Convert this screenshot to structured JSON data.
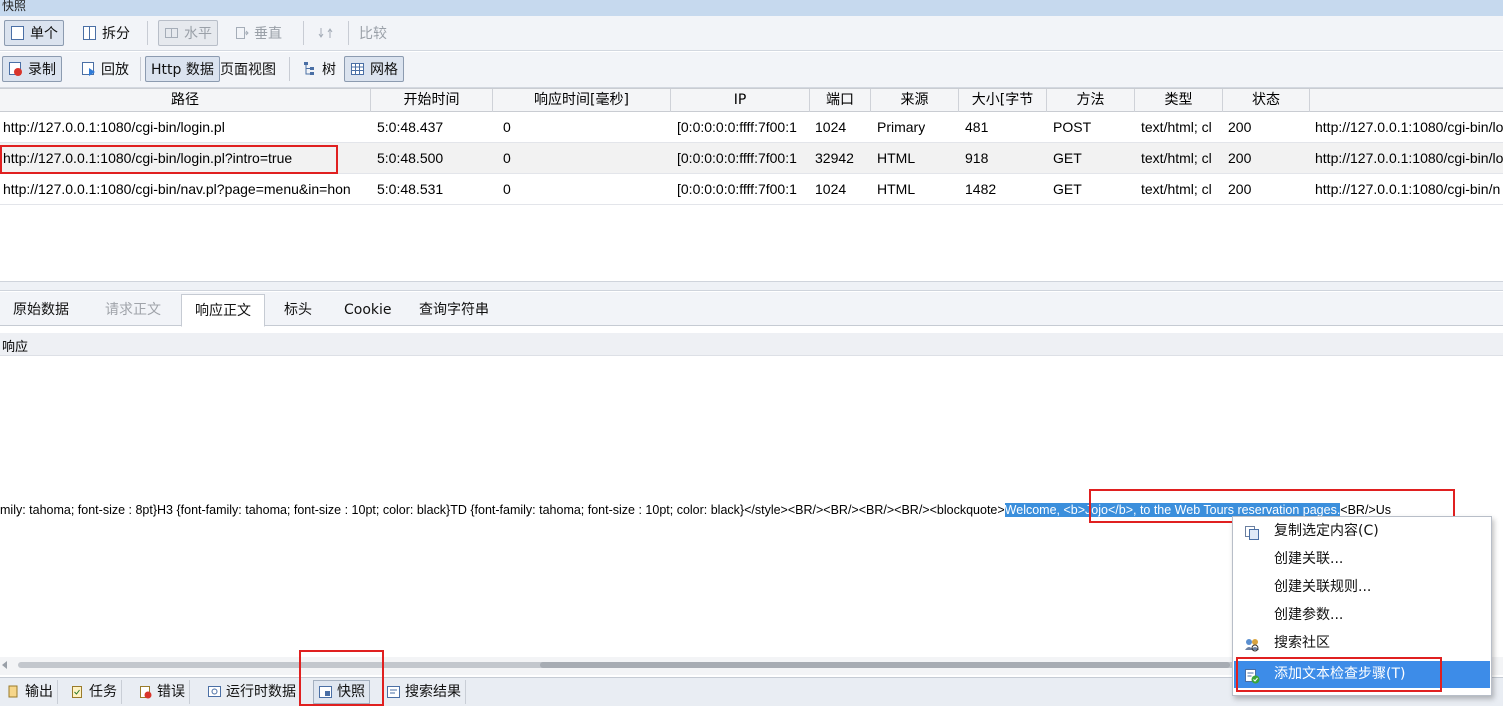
{
  "window": {
    "title": "快照"
  },
  "toolbar1": {
    "single_label": "单个",
    "split_label": "拆分",
    "horizontal_label": "水平",
    "vertical_label": "垂直",
    "compare_label": "比较"
  },
  "toolbar2": {
    "record_label": "录制",
    "replay_label": "回放",
    "http_data_label": "Http 数据",
    "page_view_label": "页面视图",
    "tree_label": "树",
    "grid_label": "网格"
  },
  "grid": {
    "columns": [
      "路径",
      "开始时间",
      "响应时间[毫秒]",
      "IP",
      "端口",
      "来源",
      "大小[字节",
      "方法",
      "类型",
      "状态"
    ],
    "rows": [
      {
        "path": "http://127.0.0.1:1080/cgi-bin/login.pl",
        "start": "5:0:48.437",
        "resp": "0",
        "ip": "[0:0:0:0:0:ffff:7f00:1",
        "port": "1024",
        "source": "Primary",
        "size": "481",
        "method": "POST",
        "type": "text/html; cl",
        "status": "200",
        "referer": "http://127.0.0.1:1080/cgi-bin/lo"
      },
      {
        "path": "http://127.0.0.1:1080/cgi-bin/login.pl?intro=true",
        "start": "5:0:48.500",
        "resp": "0",
        "ip": "[0:0:0:0:0:ffff:7f00:1",
        "port": "32942",
        "source": "HTML",
        "size": "918",
        "method": "GET",
        "type": "text/html; cl",
        "status": "200",
        "referer": "http://127.0.0.1:1080/cgi-bin/lo"
      },
      {
        "path": "http://127.0.0.1:1080/cgi-bin/nav.pl?page=menu&in=hon",
        "start": "5:0:48.531",
        "resp": "0",
        "ip": "[0:0:0:0:0:ffff:7f00:1",
        "port": "1024",
        "source": "HTML",
        "size": "1482",
        "method": "GET",
        "type": "text/html; cl",
        "status": "200",
        "referer": "http://127.0.0.1:1080/cgi-bin/n"
      }
    ]
  },
  "detail_tabs": [
    "原始数据",
    "请求正文",
    "响应正文",
    "标头",
    "Cookie",
    "查询字符串"
  ],
  "response": {
    "section_label": "响应",
    "text_before": "mily: tahoma; font-size : 8pt}H3 {font-family: tahoma; font-size : 10pt; color: black}TD {font-family: tahoma; font-size : 10pt; color: black}</style><BR/><BR/><BR/><BR/><blockquote>",
    "text_selected": "Welcome, <b>Jojo</b>, to the Web Tours reservation pages.",
    "text_after": "<BR/>Us"
  },
  "context_menu": {
    "items": [
      "复制选定内容(C)",
      "创建关联...",
      "创建关联规则...",
      "创建参数...",
      "搜索社区",
      "添加文本检查步骤(T)"
    ]
  },
  "bottom_tabs": [
    "输出",
    "任务",
    "错误",
    "运行时数据",
    "快照",
    "搜索结果"
  ],
  "colors": {
    "highlight": "#3b8fdc",
    "annotation_red": "#e02020",
    "menu_hover": "#3d8ce8"
  }
}
